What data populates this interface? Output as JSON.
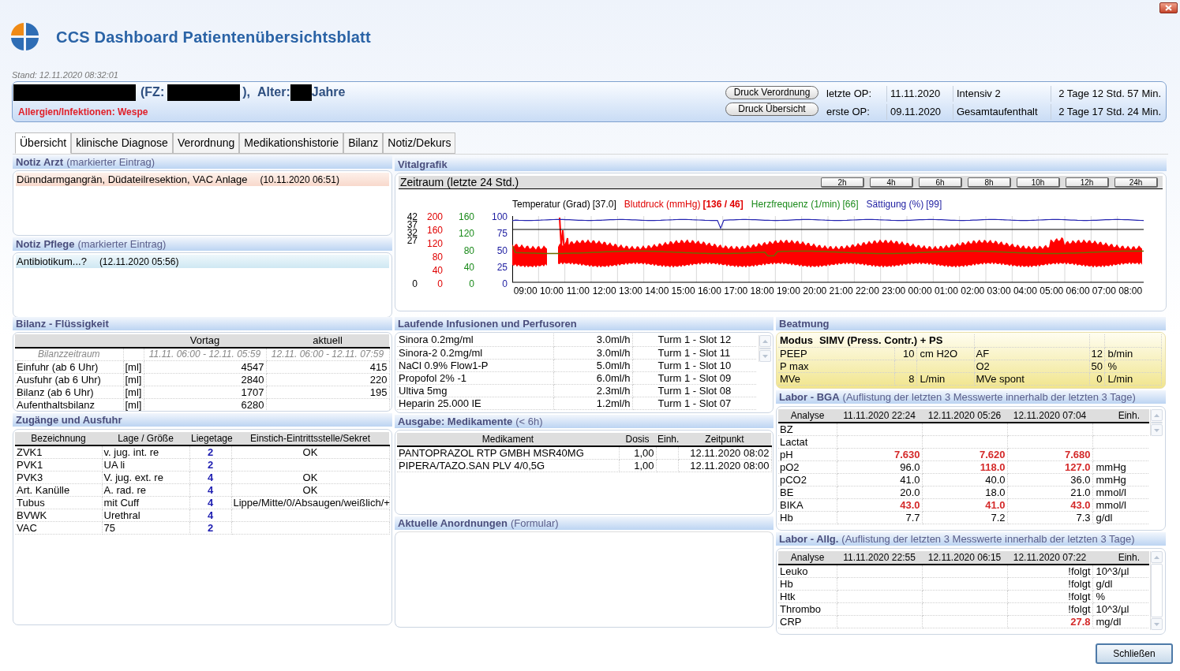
{
  "window": {
    "title": "CCS Dashboard Patientenübersichtsblatt"
  },
  "stand": "Stand: 12.11.2020 08:32:01",
  "patient": {
    "fz_label": "(FZ:",
    "fz_close": "),",
    "age_label": "Alter:",
    "age_suffix": "Jahre",
    "allergies": "Allergien/Infektionen: Wespe"
  },
  "print_buttons": [
    "Druck Verordnung",
    "Druck Übersicht"
  ],
  "op_info": [
    {
      "label": "letzte OP:",
      "date": "11.11.2020",
      "stay": "Intensiv 2",
      "duration": "2 Tage 12 Std. 57 Min."
    },
    {
      "label": "erste OP:",
      "date": "09.11.2020",
      "stay": "Gesamtaufenthalt",
      "duration": "2 Tage 17 Std. 24 Min."
    }
  ],
  "tabs": [
    {
      "label": "Übersicht",
      "selected": true
    },
    {
      "label": "klinische Diagnose",
      "selected": false
    },
    {
      "label": "Verordnung",
      "selected": false
    },
    {
      "label": "Medikationshistorie",
      "selected": false
    },
    {
      "label": "Bilanz",
      "selected": false
    },
    {
      "label": "Notiz/Dekurs",
      "selected": false
    }
  ],
  "notiz_arzt": {
    "title": "Notiz Arzt",
    "subtitle": "(markierter Eintrag)",
    "entry": "Dünndarmgangrän, Düdateilresektion, VAC Anlage",
    "time": "(10.11.2020 06:51)"
  },
  "notiz_pflege": {
    "title": "Notiz Pflege",
    "subtitle": "(markierter Eintrag)",
    "entry": "Antibiotikum...?",
    "time": "(12.11.2020 05:56)"
  },
  "vitalgrafik": {
    "title": "Vitalgrafik",
    "zeitraum": "Zeitraum (letzte 24 Std.)",
    "range_buttons": [
      "2h",
      "4h",
      "6h",
      "8h",
      "10h",
      "12h",
      "24h"
    ],
    "legend": [
      {
        "label": "Temperatur (Grad)",
        "value": "[37.0]",
        "color": "#000000",
        "value_bold": false
      },
      {
        "label": "Blutdruck (mmHg)",
        "value": "[136 / 46]",
        "color": "#e00000",
        "value_bold": true
      },
      {
        "label": "Herzfrequenz (1/min)",
        "value": "[66]",
        "color": "#1a8a1a",
        "value_bold": false
      },
      {
        "label": "Sättigung (%)",
        "value": "[99]",
        "color": "#1c1ca0",
        "value_bold": false
      }
    ],
    "y_axes": [
      {
        "kind": "stacked",
        "color": "#000000",
        "ticks": [
          "42",
          "37",
          "32",
          "27",
          "0"
        ]
      },
      {
        "kind": "even",
        "color": "#e00000",
        "ticks": [
          "200",
          "160",
          "120",
          "80",
          "40",
          "0"
        ]
      },
      {
        "kind": "even",
        "color": "#1a8a1a",
        "ticks": [
          "160",
          "120",
          "80",
          "40",
          "0"
        ]
      },
      {
        "kind": "even",
        "color": "#1c1ca0",
        "ticks": [
          "100",
          "75",
          "50",
          "25",
          "0"
        ]
      }
    ],
    "x_ticks": [
      "09:00",
      "10:00",
      "11:00",
      "12:00",
      "13:00",
      "14:00",
      "15:00",
      "16:00",
      "17:00",
      "18:00",
      "19:00",
      "20:00",
      "21:00",
      "22:00",
      "23:00",
      "00:00",
      "01:00",
      "02:00",
      "03:00",
      "04:00",
      "05:00",
      "06:00",
      "07:00",
      "08:00"
    ]
  },
  "bilanz": {
    "title": "Bilanz - Flüssigkeit",
    "columns": [
      "Vortag",
      "aktuell"
    ],
    "period": {
      "label": "Bilanzzeitraum",
      "vortag": "11.11. 06:00 - 12.11. 05:59",
      "aktuell": "12.11. 06:00 - 12.11. 07:59"
    },
    "rows": [
      {
        "label": "Einfuhr (ab 6 Uhr)",
        "unit": "[ml]",
        "vortag": "4547",
        "aktuell": "415"
      },
      {
        "label": "Ausfuhr (ab 6 Uhr)",
        "unit": "[ml]",
        "vortag": "2840",
        "aktuell": "220"
      },
      {
        "label": "Bilanz (ab 6 Uhr)",
        "unit": "[ml]",
        "vortag": "1707",
        "aktuell": "195"
      },
      {
        "label": "Aufenthaltsbilanz",
        "unit": "[ml]",
        "vortag": "6280"
      }
    ]
  },
  "zugaenge": {
    "title": "Zugänge und Ausfuhr",
    "columns": [
      "Bezeichnung",
      "Lage / Größe",
      "Liegetage",
      "Einstich-Eintrittsstelle/Sekret"
    ],
    "rows": [
      {
        "name": "ZVK1",
        "lage": "v. jug. int. re",
        "tage": "2",
        "sekret": "OK"
      },
      {
        "name": "PVK1",
        "lage": "UA li",
        "tage": "2"
      },
      {
        "name": "PVK3",
        "lage": "V. jug. ext. re",
        "tage": "4",
        "sekret": "OK"
      },
      {
        "name": "Art. Kanülle",
        "lage": "A. rad. re",
        "tage": "4",
        "sekret": "OK"
      },
      {
        "name": "Tubus",
        "lage": "mit Cuff",
        "tage": "4",
        "sekret": "Lippe/Mitte/0/Absaugen/weißlich/+"
      },
      {
        "name": "BVWK",
        "lage": "Urethral",
        "tage": "4"
      },
      {
        "name": "VAC",
        "lage": "75",
        "tage": "2"
      }
    ]
  },
  "infusionen": {
    "title": "Laufende Infusionen und Perfusoren",
    "rows": [
      {
        "name": "Sinora 0.2mg/ml",
        "rate": "3.0ml/h",
        "slot": "Turm 1 - Slot 12"
      },
      {
        "name": "Sinora-2 0.2mg/ml",
        "rate": "3.0ml/h",
        "slot": "Turm 1 - Slot 11"
      },
      {
        "name": "NaCl 0.9% Flow1-P",
        "rate": "5.0ml/h",
        "slot": "Turm 1 - Slot 10"
      },
      {
        "name": "Propofol 2% -1",
        "rate": "6.0ml/h",
        "slot": "Turm 1 - Slot 09"
      },
      {
        "name": "Ultiva 5mg",
        "rate": "2.3ml/h",
        "slot": "Turm 1 - Slot 08"
      },
      {
        "name": "Heparin 25.000 IE",
        "rate": "1.2ml/h",
        "slot": "Turm 1 - Slot 07"
      }
    ]
  },
  "medikamente": {
    "title": "Ausgabe: Medikamente",
    "subtitle": "(< 6h)",
    "columns": [
      "Medikament",
      "Dosis",
      "Einh.",
      "Zeitpunkt"
    ],
    "rows": [
      {
        "name": "PANTOPRAZOL RTP GMBH MSR40MG",
        "dosis": "1,00",
        "zeit": "12.11.2020 08:02"
      },
      {
        "name": "PIPERA/TAZO.SAN PLV 4/0,5G",
        "dosis": "1,00",
        "zeit": "12.11.2020 08:00"
      }
    ]
  },
  "anordnungen": {
    "title": "Aktuelle Anordnungen",
    "subtitle": "(Formular)"
  },
  "beatmung": {
    "title": "Beatmung",
    "modus_label": "Modus",
    "modus": "SIMV (Press. Contr.) + PS",
    "rows": [
      {
        "label": "PEEP",
        "value": "10",
        "unit": "cm H2O",
        "label2": "AF",
        "value2": "12",
        "unit2": "b/min"
      },
      {
        "label": "P max",
        "label2": "O2",
        "value2": "50",
        "unit2": "%"
      },
      {
        "label": "MVe",
        "value": "8",
        "unit": "L/min",
        "label2": "MVe spont",
        "value2": "0",
        "unit2": "L/min"
      }
    ]
  },
  "labor_bga": {
    "title": "Labor - BGA",
    "subtitle": "(Auflistung der letzten 3 Messwerte innerhalb der letzten 3 Tage)",
    "columns": [
      "Analyse",
      "11.11.2020 22:24",
      "12.11.2020 05:26",
      "12.11.2020 07:04",
      "Einh."
    ],
    "rows": [
      {
        "name": "BZ"
      },
      {
        "name": "Lactat"
      },
      {
        "name": "pH",
        "v1": {
          "text": "7.630",
          "abnormal": true
        },
        "v2": {
          "text": "7.620",
          "abnormal": true
        },
        "v3": {
          "text": "7.680",
          "abnormal": true
        }
      },
      {
        "name": "pO2",
        "v1": {
          "text": "96.0",
          "abnormal": false
        },
        "v2": {
          "text": "118.0",
          "abnormal": true
        },
        "v3": {
          "text": "127.0",
          "abnormal": true
        },
        "unit": "mmHg"
      },
      {
        "name": "pCO2",
        "v1": {
          "text": "41.0",
          "abnormal": false
        },
        "v2": {
          "text": "40.0",
          "abnormal": false
        },
        "v3": {
          "text": "36.0",
          "abnormal": false
        },
        "unit": "mmHg"
      },
      {
        "name": "BE",
        "v1": {
          "text": "20.0",
          "abnormal": false
        },
        "v2": {
          "text": "18.0",
          "abnormal": false
        },
        "v3": {
          "text": "21.0",
          "abnormal": false
        },
        "unit": "mmol/l"
      },
      {
        "name": "BIKA",
        "v1": {
          "text": "43.0",
          "abnormal": true
        },
        "v2": {
          "text": "41.0",
          "abnormal": true
        },
        "v3": {
          "text": "43.0",
          "abnormal": true
        },
        "unit": "mmol/l"
      },
      {
        "name": "Hb",
        "v1": {
          "text": "7.7",
          "abnormal": false
        },
        "v2": {
          "text": "7.2",
          "abnormal": false
        },
        "v3": {
          "text": "7.3",
          "abnormal": false
        },
        "unit": "g/dl"
      }
    ]
  },
  "labor_allg": {
    "title": "Labor - Allg.",
    "subtitle": "(Auflistung der letzten 3 Messwerte innerhalb der letzten 3 Tage)",
    "columns": [
      "Analyse",
      "11.11.2020 22:55",
      "12.11.2020 06:15",
      "12.11.2020 07:22",
      "Einh."
    ],
    "rows": [
      {
        "name": "Leuko",
        "v3": {
          "text": "!folgt",
          "abnormal": false
        },
        "unit": "10^3/µl"
      },
      {
        "name": "Hb",
        "v3": {
          "text": "!folgt",
          "abnormal": false
        },
        "unit": "g/dl"
      },
      {
        "name": "Htk",
        "v3": {
          "text": "!folgt",
          "abnormal": false
        },
        "unit": "%"
      },
      {
        "name": "Thrombo",
        "v3": {
          "text": "!folgt",
          "abnormal": false
        },
        "unit": "10^3/µl"
      },
      {
        "name": "CRP",
        "v3": {
          "text": "27.8",
          "abnormal": true
        },
        "unit": "mg/dl"
      }
    ]
  },
  "close_button": "Schließen"
}
